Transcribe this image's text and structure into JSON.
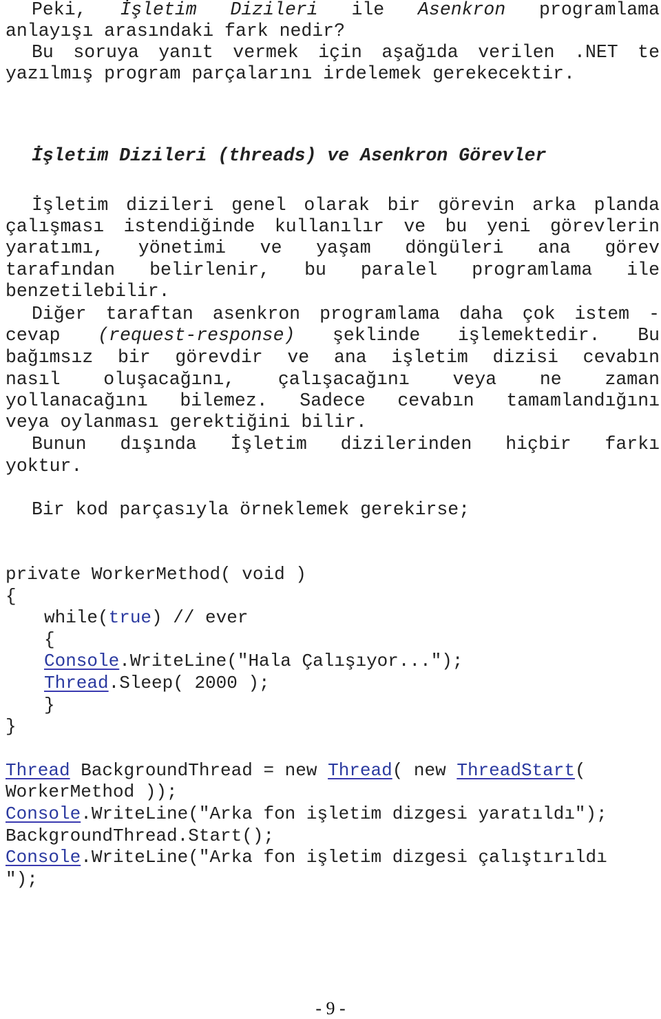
{
  "intro": {
    "l1": {
      "a": "Peki, ",
      "b": "İşletim Dizileri",
      "c": " ile ",
      "d": "Asenkron",
      "e": " programlama"
    },
    "l2": "anlayışı arasındaki fark nedir?",
    "l3": "Bu soruya yanıt vermek için aşağıda verilen .NET te",
    "l4": "yazılmış program parçalarını irdelemek gerekecektir."
  },
  "heading": "İşletim Dizileri (threads) ve Asenkron Görevler",
  "para1": [
    "İşletim dizileri genel olarak bir görevin arka planda",
    "çalışması istendiğinde kullanılır ve bu yeni görevlerin",
    "yaratımı, yönetimi ve yaşam döngüleri ana görev",
    "tarafından belirlenir, bu paralel programlama ile",
    "benzetilebilir."
  ],
  "para2": {
    "l1": "Diğer taraftan asenkron programlama daha çok istem -",
    "l2": {
      "a": "cevap ",
      "b": "(request-response)",
      "c": " şeklinde işlemektedir. Bu"
    },
    "l3": "bağımsız bir görevdir ve ana işletim dizisi cevabın",
    "l4": "nasıl oluşacağını, çalışacağını veya ne zaman",
    "l5": "yollanacağını bilemez. Sadece cevabın tamamlandığını",
    "l6": "veya oylanması gerektiğini bilir."
  },
  "para3": {
    "l1": "Bunun dışında İşletim dizilerinden hiçbir farkı",
    "l2": "yoktur."
  },
  "code_intro": "Bir kod parçasıyla örneklemek gerekirse;",
  "code1": {
    "signature": "private WorkerMethod( void )",
    "open_brace": "{",
    "while_a": "while(",
    "while_kw": "true",
    "while_b": ") // ever",
    "inner_open": "{",
    "console_type": "Console",
    "console_call": ".WriteLine(\"Hala Çalışıyor...\");",
    "thread_type": "Thread",
    "thread_call": ".Sleep( 2000 );",
    "inner_close": "}",
    "close_brace": "}"
  },
  "code2": {
    "l1": {
      "t1": "Thread",
      "a": " BackgroundThread = new ",
      "t2": "Thread",
      "b": "( new ",
      "t3": "ThreadStart",
      "c": "("
    },
    "l2": "WorkerMethod ));",
    "l3": {
      "t": "Console",
      "a": ".WriteLine(\"Arka fon işletim dizgesi yaratıldı\");"
    },
    "l4": "BackgroundThread.Start();",
    "l5": {
      "t": "Console",
      "a": ".WriteLine(\"Arka fon işletim dizgesi çalıştırıldı"
    },
    "l6": "\");"
  },
  "page_number": "- 9 -",
  "colors": {
    "keyword": "#2b3aa0",
    "text": "#222222"
  }
}
